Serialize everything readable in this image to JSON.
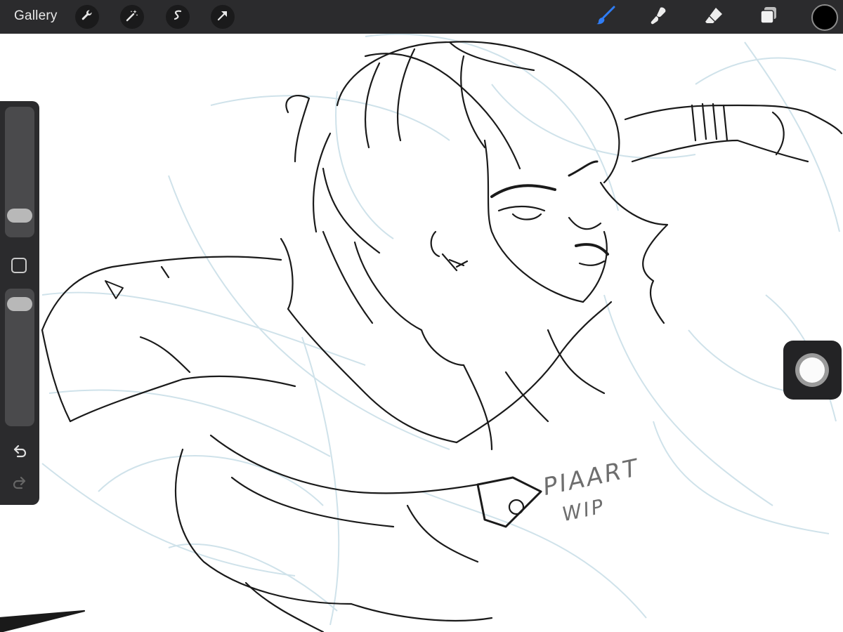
{
  "toolbar": {
    "gallery_label": "Gallery",
    "left_tools": [
      "wrench-icon",
      "magic-wand-icon",
      "selection-s-icon",
      "transform-arrow-icon"
    ],
    "right_tools": [
      "brush-icon",
      "smudge-icon",
      "eraser-icon",
      "layers-icon"
    ],
    "active_tool": "brush-icon",
    "active_color": "#000000",
    "brush_accent": "#2f7df6"
  },
  "sidebar": {
    "size_slider_level": 0.28,
    "opacity_slider_level": 0.93
  },
  "canvas": {
    "signature_line1": "PIAART",
    "signature_line2": "WIP",
    "sketch_color": "#cfe2ea",
    "ink_color": "#1a1a1a"
  }
}
